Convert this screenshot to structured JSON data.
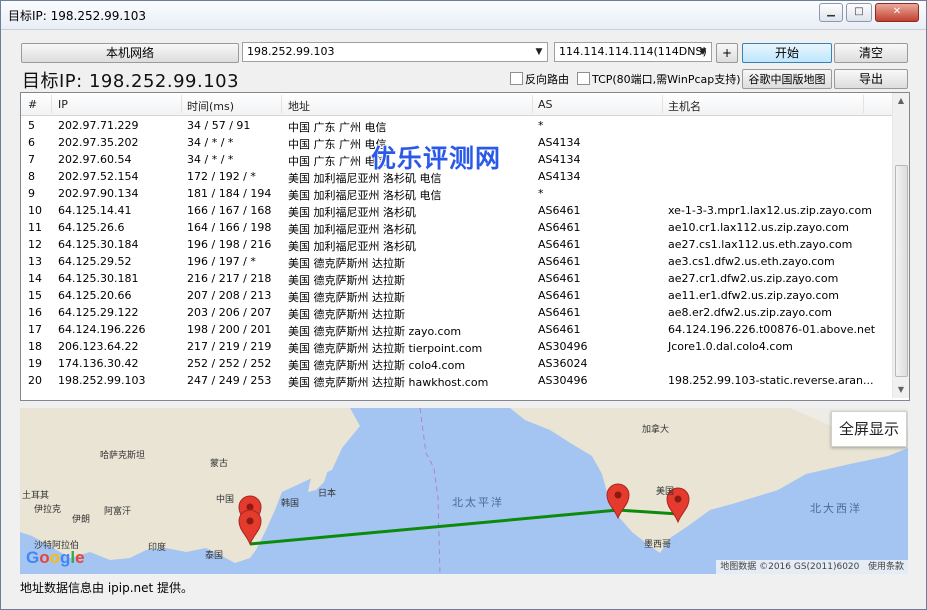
{
  "window": {
    "title": "目标IP: 198.252.99.103",
    "min_label": "▁",
    "max_label": "□",
    "close_label": "✕"
  },
  "toolbar": {
    "local_network_label": "本机网络",
    "target_input_value": "198.252.99.103",
    "dns_select_value": "114.114.114.114(114DNS)",
    "add_label": "+",
    "start_label": "开始",
    "clear_label": "清空",
    "map_label": "谷歌中国版地图",
    "export_label": "导出"
  },
  "target_display": "目标IP: 198.252.99.103",
  "options": {
    "reverse_route_label": "反向路由",
    "tcp_label": "TCP(80端口,需WinPcap支持)"
  },
  "table": {
    "headers": [
      "#",
      "IP",
      "时间(ms)",
      "地址",
      "AS",
      "主机名"
    ],
    "rows": [
      [
        "5",
        "202.97.71.229",
        "34 / 57 / 91",
        "中国 广东 广州 电信",
        "*",
        ""
      ],
      [
        "6",
        "202.97.35.202",
        "34 / * / *",
        "中国 广东 广州 电信",
        "AS4134",
        ""
      ],
      [
        "7",
        "202.97.60.54",
        "34 / * / *",
        "中国 广东 广州 电信",
        "AS4134",
        ""
      ],
      [
        "8",
        "202.97.52.154",
        "172 / 192 / *",
        "美国 加利福尼亚州 洛杉矶 电信",
        "AS4134",
        ""
      ],
      [
        "9",
        "202.97.90.134",
        "181 / 184 / 194",
        "美国 加利福尼亚州 洛杉矶 电信",
        "*",
        ""
      ],
      [
        "10",
        "64.125.14.41",
        "166 / 167 / 168",
        "美国 加利福尼亚州 洛杉矶",
        "AS6461",
        "xe-1-3-3.mpr1.lax12.us.zip.zayo.com"
      ],
      [
        "11",
        "64.125.26.6",
        "164 / 166 / 198",
        "美国 加利福尼亚州 洛杉矶",
        "AS6461",
        "ae10.cr1.lax112.us.zip.zayo.com"
      ],
      [
        "12",
        "64.125.30.184",
        "196 / 198 / 216",
        "美国 加利福尼亚州 洛杉矶",
        "AS6461",
        "ae27.cs1.lax112.us.eth.zayo.com"
      ],
      [
        "13",
        "64.125.29.52",
        "196 / 197 / *",
        "美国 德克萨斯州 达拉斯",
        "AS6461",
        "ae3.cs1.dfw2.us.eth.zayo.com"
      ],
      [
        "14",
        "64.125.30.181",
        "216 / 217 / 218",
        "美国 德克萨斯州 达拉斯",
        "AS6461",
        "ae27.cr1.dfw2.us.zip.zayo.com"
      ],
      [
        "15",
        "64.125.20.66",
        "207 / 208 / 213",
        "美国 德克萨斯州 达拉斯",
        "AS6461",
        "ae11.er1.dfw2.us.zip.zayo.com"
      ],
      [
        "16",
        "64.125.29.122",
        "203 / 206 / 207",
        "美国 德克萨斯州 达拉斯",
        "AS6461",
        "ae8.er2.dfw2.us.zip.zayo.com"
      ],
      [
        "17",
        "64.124.196.226",
        "198 / 200 / 201",
        "美国 德克萨斯州 达拉斯 zayo.com",
        "AS6461",
        "64.124.196.226.t00876-01.above.net"
      ],
      [
        "18",
        "206.123.64.22",
        "217 / 219 / 219",
        "美国 德克萨斯州 达拉斯 tierpoint.com",
        "AS30496",
        "Jcore1.0.dal.colo4.com"
      ],
      [
        "19",
        "174.136.30.42",
        "252 / 252 / 252",
        "美国 德克萨斯州 达拉斯 colo4.com",
        "AS36024",
        ""
      ],
      [
        "20",
        "198.252.99.103",
        "247 / 249 / 253",
        "美国 德克萨斯州 达拉斯 hawkhost.com",
        "AS30496",
        "198.252.99.103-static.reverse.aran..."
      ]
    ]
  },
  "watermark": "优乐评测网",
  "map": {
    "fullscreen_label": "全屏显示",
    "labels": [
      "哈萨克斯坦",
      "蒙古",
      "中国",
      "韩国",
      "日本",
      "土耳其",
      "伊拉克",
      "伊朗",
      "阿富汗",
      "沙特阿拉伯",
      "印度",
      "泰国",
      "加拿大",
      "美国",
      "墨西哥"
    ],
    "oceans": [
      "北太平洋",
      "北大西洋"
    ],
    "google_logo": "Google",
    "map_data_label": "地图数据 ©2016 GS(2011)6020",
    "terms_label": "使用条款",
    "route_color": "#0c8a0c",
    "pin_color": "#e53a2e"
  },
  "status_text": "地址数据信息由 ipip.net 提供。"
}
